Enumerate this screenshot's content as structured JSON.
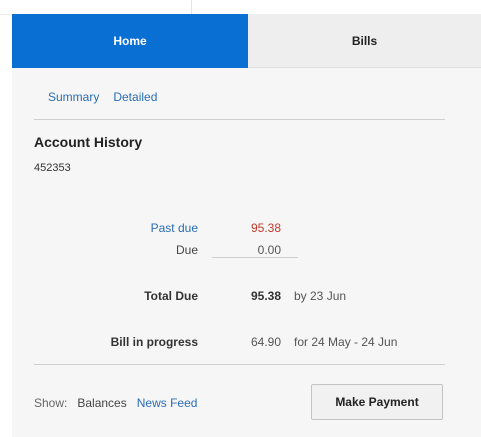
{
  "tabs": {
    "home": "Home",
    "bills": "Bills"
  },
  "subnav": {
    "summary": "Summary",
    "detailed": "Detailed"
  },
  "account": {
    "title": "Account History",
    "number": "452353"
  },
  "rows": {
    "past_due": {
      "label": "Past due",
      "value": "95.38"
    },
    "due": {
      "label": "Due",
      "value": "0.00"
    },
    "total_due": {
      "label": "Total Due",
      "value": "95.38",
      "note": "by 23 Jun"
    },
    "bill_in_progress": {
      "label": "Bill in progress",
      "value": "64.90",
      "note": "for 24 May - 24 Jun"
    }
  },
  "footer": {
    "show_label": "Show:",
    "balances": "Balances",
    "news_feed": "News Feed",
    "make_payment": "Make Payment"
  },
  "colors": {
    "active_tab": "#0a6fd3",
    "link": "#2a6db5",
    "past_due_value": "#c0392b",
    "panel_bg": "#f6f6f6"
  }
}
